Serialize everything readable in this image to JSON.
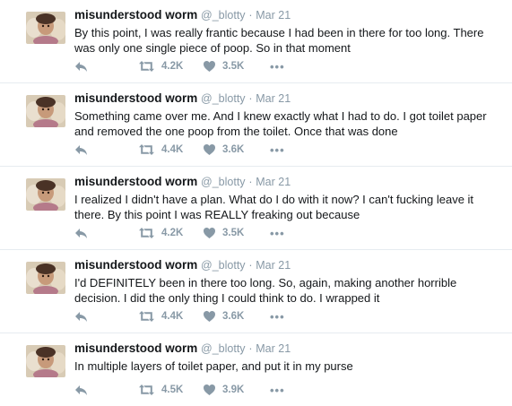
{
  "tweets": [
    {
      "name": "misunderstood worm",
      "handle": "@_blotty",
      "separator": "·",
      "date": "Mar 21",
      "text": "By this point, I was really frantic because I had been in there for too long. There was only one single piece of poop. So in that moment",
      "retweets": "4.2K",
      "likes": "3.5K"
    },
    {
      "name": "misunderstood worm",
      "handle": "@_blotty",
      "separator": "·",
      "date": "Mar 21",
      "text": "Something came over me. And I knew exactly what I had to do. I got toilet paper and removed the one poop from the toilet. Once that was done",
      "retweets": "4.4K",
      "likes": "3.6K"
    },
    {
      "name": "misunderstood worm",
      "handle": "@_blotty",
      "separator": "·",
      "date": "Mar 21",
      "text": "I realized I didn't have a plan. What do I do with it now? I can't fucking leave it there. By this point I was REALLY freaking out because",
      "retweets": "4.2K",
      "likes": "3.5K"
    },
    {
      "name": "misunderstood worm",
      "handle": "@_blotty",
      "separator": "·",
      "date": "Mar 21",
      "text": "I'd DEFINITELY been in there too long. So, again, making another horrible decision. I did the only thing I could think to do. I wrapped it",
      "retweets": "4.4K",
      "likes": "3.6K"
    },
    {
      "name": "misunderstood worm",
      "handle": "@_blotty",
      "separator": "·",
      "date": "Mar 21",
      "text": "In multiple layers of toilet paper, and put it in my purse",
      "retweets": "4.5K",
      "likes": "3.9K"
    }
  ],
  "more_label": "•••",
  "icons": {
    "reply": "reply-icon",
    "retweet": "retweet-icon",
    "like": "heart-icon",
    "more": "more-icon"
  },
  "colors": {
    "name": "#14171a",
    "meta": "#8899a6",
    "divider": "#e6ecf0"
  }
}
